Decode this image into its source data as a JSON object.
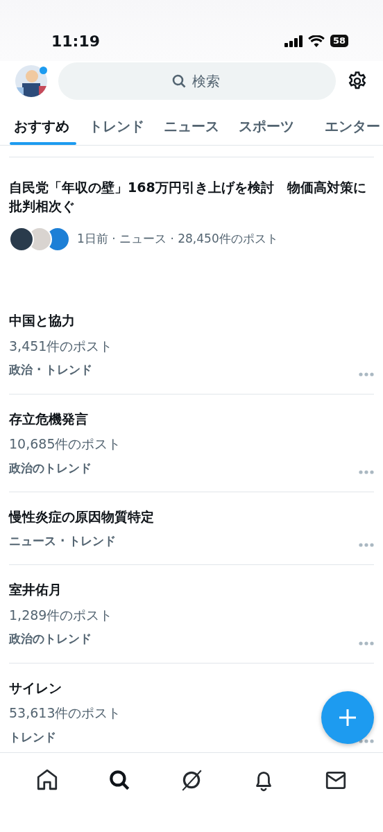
{
  "status_bar": {
    "time": "11:19",
    "battery": "58"
  },
  "header": {
    "search": {
      "placeholder": "検索"
    },
    "avatar_badge": true
  },
  "tabs": [
    {
      "label": "おすすめ",
      "selected": true
    },
    {
      "label": "トレンド",
      "selected": false
    },
    {
      "label": "ニュース",
      "selected": false
    },
    {
      "label": "スポーツ",
      "selected": false
    },
    {
      "label": "エンター",
      "selected": false
    }
  ],
  "news": {
    "headline": "自民党「年収の壁」168万円引き上げを検討　物価高対策に批判相次ぐ",
    "meta": "1日前 · ニュース · 28,450件のポスト"
  },
  "trends": [
    {
      "title": "中国と協力",
      "count": "3,451件のポスト",
      "category": "政治 · トレンド"
    },
    {
      "title": "存立危機発言",
      "count": "10,685件のポスト",
      "category": "政治のトレンド"
    },
    {
      "title": "慢性炎症の原因物質特定",
      "category": "ニュース · トレンド"
    },
    {
      "title": "室井佑月",
      "count": "1,289件のポスト",
      "category": "政治のトレンド"
    },
    {
      "title": "サイレン",
      "count": "53,613件のポスト",
      "category": "トレンド"
    }
  ],
  "bottom_nav": [
    {
      "kind": "home",
      "selected": false
    },
    {
      "kind": "search",
      "selected": true
    },
    {
      "kind": "grok",
      "selected": false
    },
    {
      "kind": "bell",
      "selected": false
    },
    {
      "kind": "mail",
      "selected": false
    }
  ]
}
